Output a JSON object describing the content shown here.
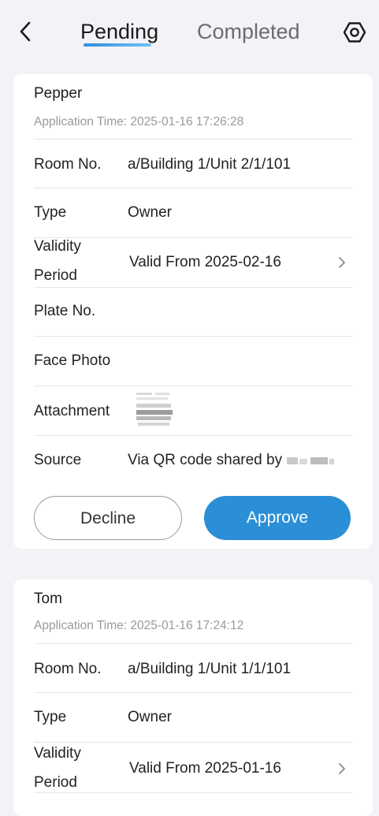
{
  "header": {
    "tabs": [
      {
        "label": "Pending",
        "active": true
      },
      {
        "label": "Completed",
        "active": false
      }
    ],
    "icons": {
      "back": "back-chevron-icon",
      "settings": "hexagon-settings-icon"
    }
  },
  "applications": [
    {
      "name": "Pepper",
      "application_time": "Application Time: 2025-01-16 17:26:28",
      "fields": {
        "room_label": "Room No.",
        "room_value": "a/Building 1/Unit 2/1/101",
        "type_label": "Type",
        "type_value": "Owner",
        "validity_label_1": "Validity",
        "validity_label_2": "Period",
        "validity_value": "Valid From 2025-02-16",
        "plate_label": "Plate No.",
        "face_label": "Face Photo",
        "attachment_label": "Attachment",
        "source_label": "Source",
        "source_value": "Via QR code shared by"
      },
      "actions": {
        "decline": "Decline",
        "approve": "Approve"
      }
    },
    {
      "name": "Tom",
      "application_time": "Application Time: 2025-01-16 17:24:12",
      "fields": {
        "room_label": "Room No.",
        "room_value": "a/Building 1/Unit 1/1/101",
        "type_label": "Type",
        "type_value": "Owner",
        "validity_label_1": "Validity",
        "validity_label_2": "Period",
        "validity_value": "Valid From 2025-01-16"
      }
    }
  ],
  "colors": {
    "accent": "#2a8fd6",
    "background": "#f2f2f7",
    "card": "#ffffff",
    "muted_text": "#9a9a9a"
  }
}
